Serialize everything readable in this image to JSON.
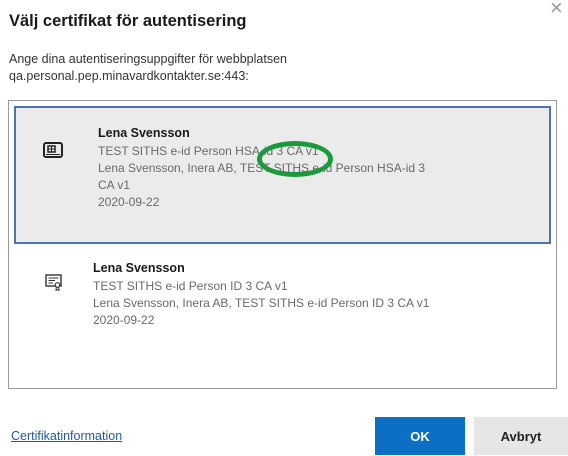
{
  "dialog": {
    "title": "Välj certifikat för autentisering",
    "description_line1": "Ange dina autentiseringsuppgifter för webbplatsen",
    "description_line2": "qa.personal.pep.minavardkontakter.se:443:"
  },
  "certificates": [
    {
      "selected": true,
      "icon": "smartcard-icon",
      "name": "Lena Svensson",
      "issuer": "TEST SITHS e-id Person HSA-id 3 CA v1",
      "details_line1": "Lena Svensson, Inera AB, TEST SITHS e-id Person HSA-id 3",
      "details_line2": "CA v1",
      "date": "2020-09-22"
    },
    {
      "selected": false,
      "icon": "certificate-icon",
      "name": "Lena Svensson",
      "issuer": "TEST SITHS e-id Person ID 3 CA v1",
      "details": "Lena Svensson, Inera AB, TEST SITHS e-id Person ID 3 CA v1",
      "date": "2020-09-22"
    }
  ],
  "footer": {
    "link_label": "Certifikatinformation",
    "ok_label": "OK",
    "cancel_label": "Avbryt"
  },
  "colors": {
    "selection_border": "#4a74b7",
    "annotation_ring": "#1a9a3c",
    "primary_button": "#0b6fc4",
    "link": "#1e5aa8"
  }
}
